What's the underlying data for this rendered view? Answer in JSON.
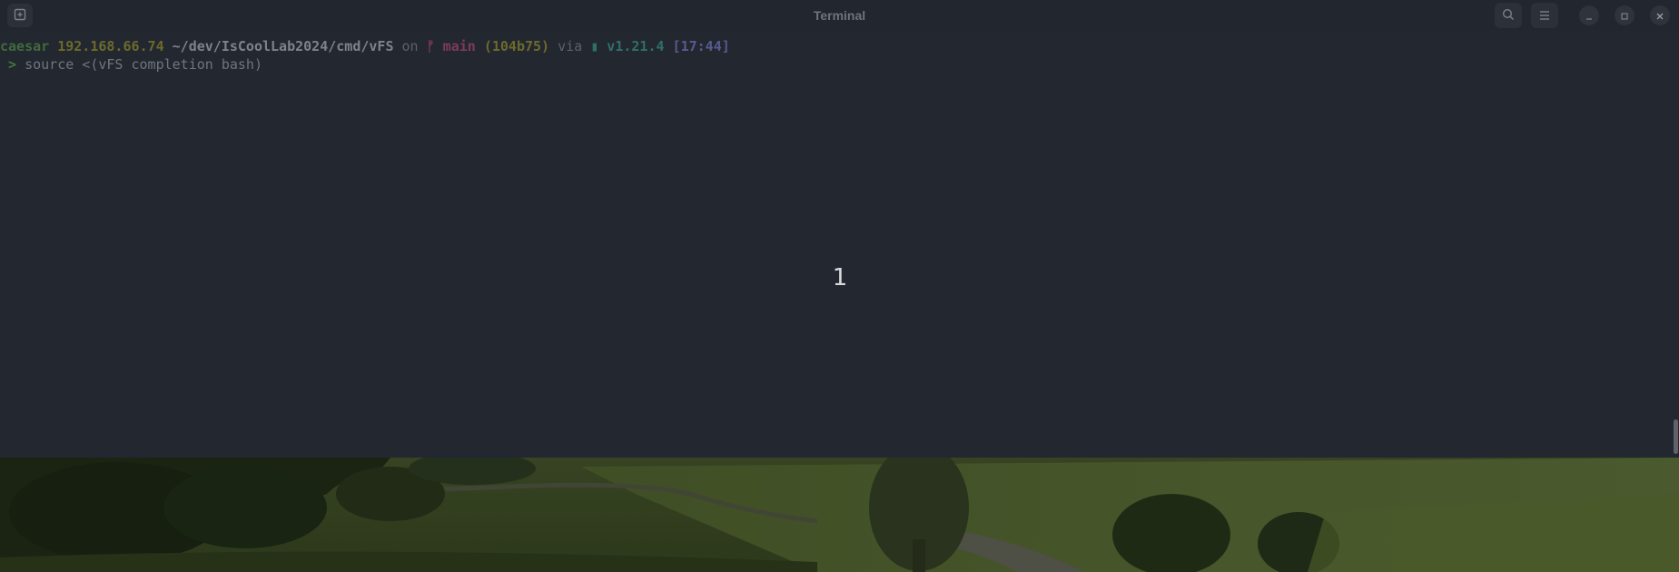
{
  "window": {
    "title": "Terminal"
  },
  "header": {
    "new_tab_icon": "new-tab-icon",
    "search_icon": "search-icon",
    "menu_icon": "hamburger-menu-icon",
    "minimize_icon": "minimize-icon",
    "maximize_icon": "maximize-icon",
    "close_icon": "close-icon"
  },
  "terminal": {
    "prompt_line": {
      "user": "caesar",
      "ip": "192.168.66.74",
      "path": "~/dev/IsCoolLab2024/cmd/vFS",
      "on_word": "on",
      "branch_symbol": "ᚠ",
      "branch": "main",
      "commit": "(104b75)",
      "via_word": "via",
      "go_symbol": "▮",
      "go_version": "v1.21.4",
      "time": "[17:44]"
    },
    "command_line": {
      "prompt_char": ">",
      "command": "source <(vFS completion bash)"
    }
  },
  "overlay": {
    "number": "1"
  },
  "colors": {
    "terminal_bg": "#232730",
    "titlebar_bg": "#22262e",
    "user": "#3f6b3d",
    "ip": "#6b6a2b",
    "path": "#7d828b",
    "branch": "#7d3a5e",
    "commit": "#6d6a2d",
    "go": "#2f6f6a",
    "time": "#585b8e"
  }
}
